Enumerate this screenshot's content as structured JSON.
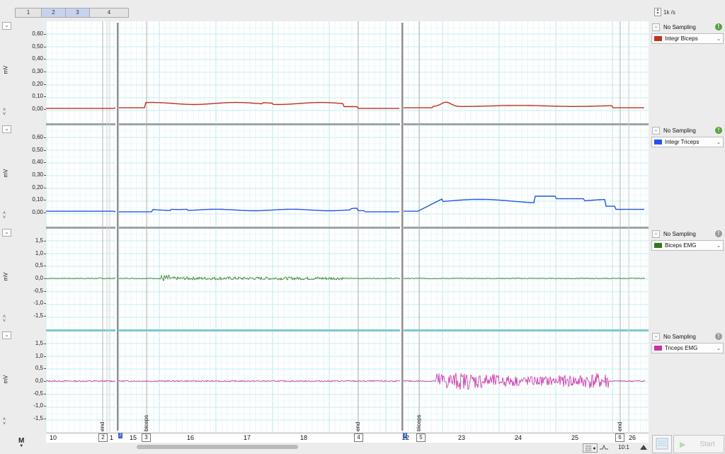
{
  "tabs": [
    "1",
    "2",
    "3",
    "4"
  ],
  "rate": "1k /s",
  "unit_label": "mV",
  "panels": [
    {
      "name": "integr-biceps",
      "ticks": [
        "0,60",
        "0,50",
        "0,40",
        "0,30",
        "0,20",
        "0,10",
        "0,00"
      ],
      "sampling": "No Sampling",
      "channel": "Integr Biceps",
      "color": "#c0311d",
      "info_color": "#56a23c"
    },
    {
      "name": "integr-triceps",
      "ticks": [
        "0,60",
        "0,50",
        "0,40",
        "0,30",
        "0,20",
        "0,10",
        "0,00"
      ],
      "sampling": "No Sampling",
      "channel": "Integr Triceps",
      "color": "#2356e8",
      "info_color": "#56a23c"
    },
    {
      "name": "biceps-emg",
      "ticks": [
        "1,5",
        "1,0",
        "0,5",
        "0,0",
        "-0,5",
        "-1,0",
        "-1,5"
      ],
      "sampling": "No Sampling",
      "channel": "Biceps EMG",
      "color": "#2f7a18",
      "info_color": "#9a9a9a"
    },
    {
      "name": "triceps-emg",
      "ticks": [
        "1,5",
        "1,0",
        "0,5",
        "0,0",
        "-0,5",
        "-1,0",
        "-1,5"
      ],
      "sampling": "No Sampling",
      "channel": "Triceps EMG",
      "color": "#cc2fa6",
      "info_color": "#9a9a9a"
    }
  ],
  "x_ticks": [
    "10",
    "1",
    "15",
    "16",
    "17",
    "18",
    "22",
    "23",
    "24",
    "25",
    "26"
  ],
  "comments": [
    {
      "label": "end",
      "box": "2"
    },
    {
      "label": "biceps",
      "box": "3"
    },
    {
      "label": "end",
      "box": "4"
    },
    {
      "label": "triceps",
      "box": "5"
    },
    {
      "label": "end",
      "box": "6"
    }
  ],
  "block_markers": [
    "2",
    "3"
  ],
  "mode_button": "M",
  "zoom": "10:1",
  "start_label": "Start"
}
